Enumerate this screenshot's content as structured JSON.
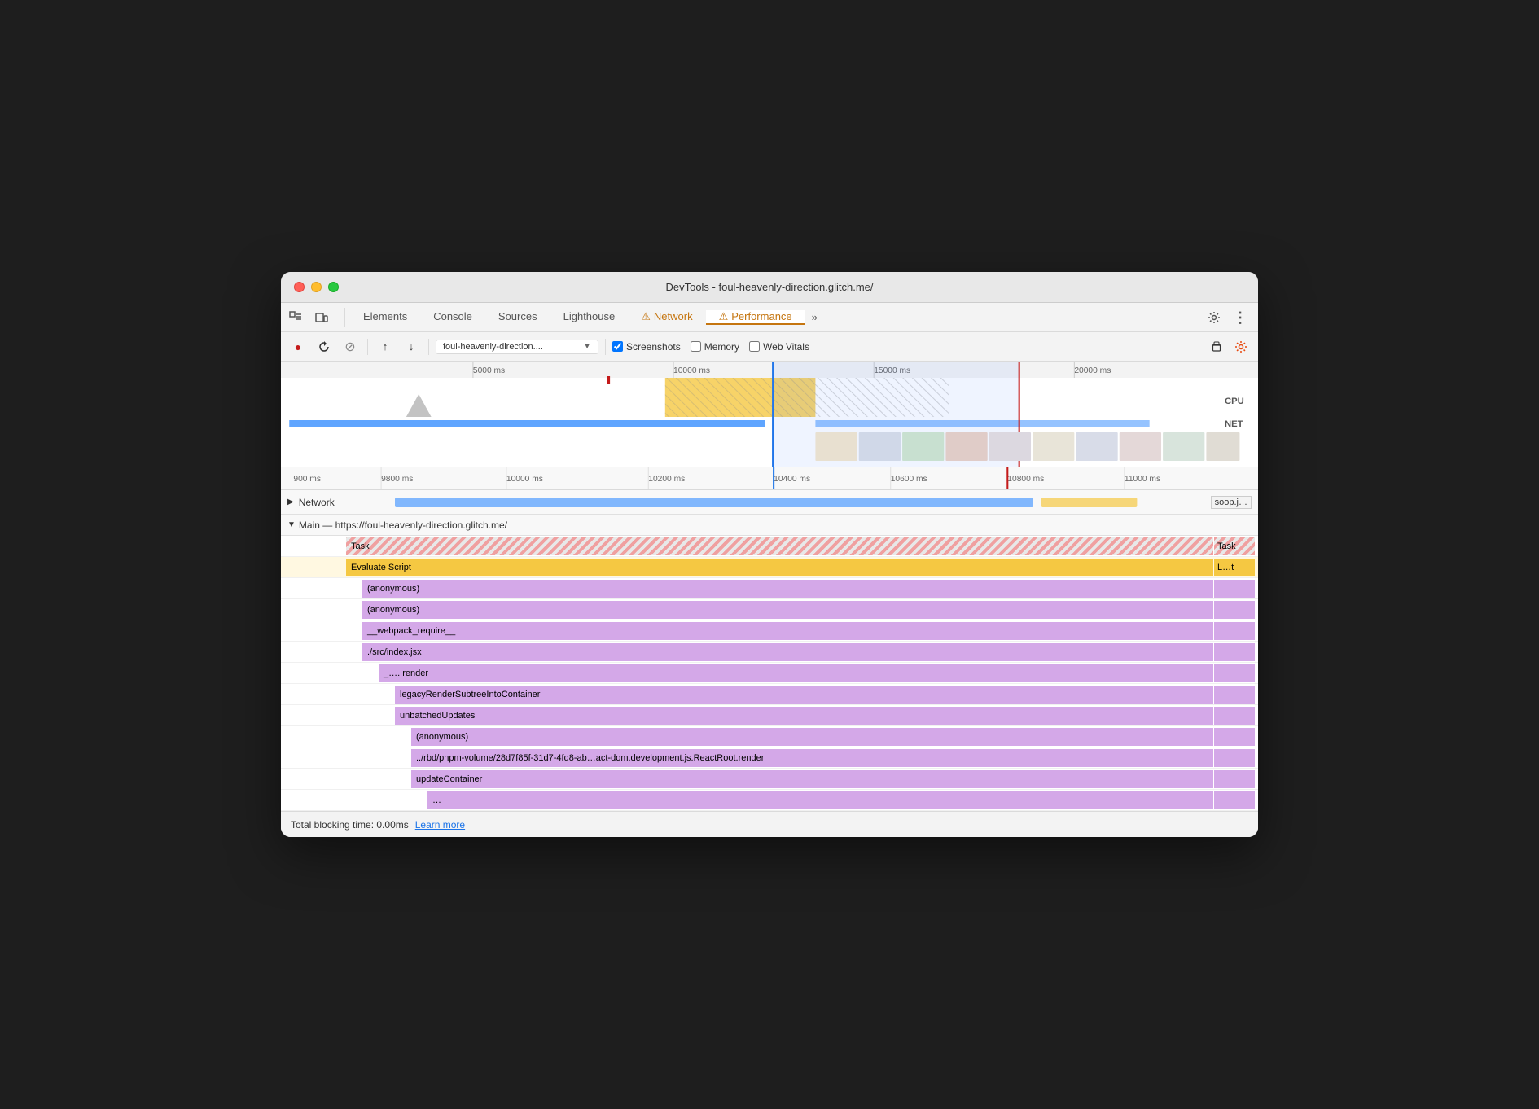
{
  "window": {
    "title": "DevTools - foul-heavenly-direction.glitch.me/"
  },
  "tabs": {
    "items": [
      {
        "id": "elements",
        "label": "Elements",
        "active": false,
        "warning": false
      },
      {
        "id": "console",
        "label": "Console",
        "active": false,
        "warning": false
      },
      {
        "id": "sources",
        "label": "Sources",
        "active": false,
        "warning": false
      },
      {
        "id": "lighthouse",
        "label": "Lighthouse",
        "active": false,
        "warning": false
      },
      {
        "id": "network",
        "label": "Network",
        "active": false,
        "warning": true
      },
      {
        "id": "performance",
        "label": "Performance",
        "active": true,
        "warning": true
      }
    ],
    "overflow_label": "»"
  },
  "toolbar": {
    "record_label": "●",
    "reload_label": "↺",
    "cancel_label": "⊘",
    "upload_label": "↑",
    "download_label": "↓",
    "url_value": "foul-heavenly-direction....",
    "screenshots_label": "Screenshots",
    "screenshots_checked": true,
    "memory_label": "Memory",
    "memory_checked": false,
    "web_vitals_label": "Web Vitals",
    "web_vitals_checked": false
  },
  "timeline": {
    "ruler_marks": [
      "5000 ms",
      "10000 ms",
      "15000 ms",
      "20000 ms"
    ],
    "cpu_label": "CPU",
    "net_label": "NET"
  },
  "zoomed_ruler": {
    "marks": [
      "900 ms",
      "9800 ms",
      "10000 ms",
      "10200 ms",
      "10400 ms",
      "10600 ms",
      "10800 ms",
      "11000 ms"
    ]
  },
  "network_section": {
    "label": "Network",
    "badge": "soop.j…"
  },
  "main_section": {
    "header": "Main — https://foul-heavenly-direction.glitch.me/",
    "rows": [
      {
        "id": "task",
        "label": "Task",
        "right_label": "Task",
        "type": "task",
        "indent": 0
      },
      {
        "id": "evaluate-script",
        "label": "Evaluate Script",
        "right_label": "L…t",
        "type": "evaluate",
        "indent": 1
      },
      {
        "id": "anon1",
        "label": "(anonymous)",
        "type": "purple",
        "indent": 2
      },
      {
        "id": "anon2",
        "label": "(anonymous)",
        "type": "purple",
        "indent": 2
      },
      {
        "id": "webpack",
        "label": "__webpack_require__",
        "type": "purple",
        "indent": 2
      },
      {
        "id": "index",
        "label": "./src/index.jsx",
        "type": "purple",
        "indent": 2
      },
      {
        "id": "render-dot",
        "label": "_…. render",
        "type": "purple",
        "indent": 3
      },
      {
        "id": "legacy-render",
        "label": "legacyRenderSubtreeIntoContainer",
        "type": "purple",
        "indent": 4
      },
      {
        "id": "unbatched",
        "label": "unbatchedUpdates",
        "type": "purple",
        "indent": 4
      },
      {
        "id": "anon3",
        "label": "(anonymous)",
        "type": "purple",
        "indent": 5
      },
      {
        "id": "rbd",
        "label": "../rbd/pnpm-volume/28d7f85f-31d7-4fd8-ab…act-dom.development.js.ReactRoot.render",
        "type": "purple",
        "indent": 5
      },
      {
        "id": "update-container",
        "label": "updateContainer",
        "type": "purple",
        "indent": 5
      },
      {
        "id": "more",
        "label": "…",
        "type": "purple",
        "indent": 6
      }
    ]
  },
  "status_bar": {
    "tbt_label": "Total blocking time: 0.00ms",
    "learn_more_label": "Learn more"
  },
  "colors": {
    "task_stripe": "#f0a0a0",
    "evaluate_script": "#f5c842",
    "purple": "#d4a8e8",
    "active_tab_underline": "#c5750f",
    "selection_blue": "#1a73e8",
    "warning_icon": "#c5750f"
  }
}
